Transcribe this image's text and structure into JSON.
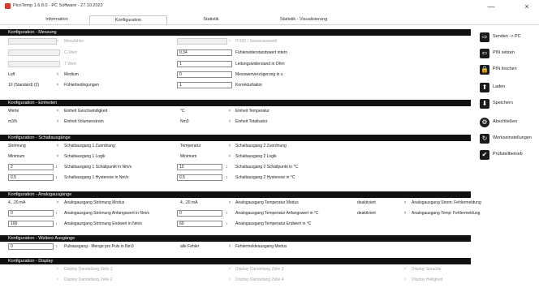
{
  "window": {
    "title": "PicoTemp 1.6.8.0 - PC Software - 27.10.2022",
    "minimize_icon": "minimize-icon",
    "close_icon": "close-icon",
    "close_glyph": "×",
    "minimize_glyph": "—"
  },
  "tabs": [
    {
      "label": "Information"
    },
    {
      "label": "Konfiguration"
    },
    {
      "label": "Statistik"
    },
    {
      "label": "Statistik - Visualisierung"
    }
  ],
  "sections": {
    "messung": "Konfiguration - Messung",
    "fuehrleistungen": "Konfiguration - Einheiten",
    "schaltausgaenge": "Konfiguration - Schaltausgänge",
    "analogausgaenge": "Konfiguration - Analogausgänge",
    "weitere": "Konfiguration - Weitere Ausgänge",
    "display": "Konfiguration - Display"
  },
  "messung": {
    "r1_left_label": "Messfühler",
    "r1_right_label": "Pt100 / Sensorauswahl",
    "r2_left_label": "C-Wert",
    "r2_right_value": "0.34",
    "r2_right_label": "Fühlerwiderstandswert intern",
    "r3_left_label": "T-Wert",
    "r3_right_value": "1",
    "r3_right_label": "Leitungswiderstand in Ohm",
    "r4_left_value": "Luft",
    "r4_left_label": "Medium",
    "r4_right_value": "0",
    "r4_right_label": "Messwertverzögerung in s",
    "r5_left_value": "10 (Standard) (2)",
    "r5_left_label": "Fühlerbedingungen",
    "r5_right_value": "1",
    "r5_right_label": "Korrekturfaktor"
  },
  "einheiten": {
    "r1_left_value": "Werte",
    "r1_left_label": "Einheit Geschwindigkeit",
    "r1_right_value": "°C",
    "r1_right_label": "Einheit Temperatur",
    "r2_left_value": "m3/h",
    "r2_left_label": "Einheit Volumenstrom",
    "r2_right_value": "Nm3",
    "r2_right_label": "Einheit Totalisator"
  },
  "schalt": {
    "r1_left_value": "Strömung",
    "r1_left_label": "Schaltausgang 1 Zuordnung",
    "r1_right_value": "Temperatur",
    "r1_right_label": "Schaltausgang 2 Zuordnung",
    "r2_left_value": "Minimum",
    "r2_left_label": "Schaltausgang 1 Logik",
    "r2_right_value": "Minimum",
    "r2_right_label": "Schaltausgang 2 Logik",
    "r3_left_value": "2",
    "r3_left_label": "Schaltausgang 1 Schaltpunkt in Nm/s",
    "r3_right_value": "10",
    "r3_right_label": "Schaltausgang 2 Schaltpunkt in °C",
    "r4_left_value": "0.5",
    "r4_left_label": "Schaltausgang 1 Hysterese in Nm/s",
    "r4_right_value": "0.5",
    "r4_right_label": "Schaltausgang 2 Hysterese in °C"
  },
  "analog": {
    "r1_left_value": "4...20 mA",
    "r1_left_label": "Analogausgang Strömung Modus",
    "r1_mid_value": "4...20 mA",
    "r1_mid_label": "Analogausgang Temperatur Modus",
    "r1_right_value": "deaktiviert",
    "r1_right_label": "Analogausgang Strom: Fehlermeldung",
    "r2_left_value": "0",
    "r2_left_label": "Analogausgang Strömung Anfangswert in Nm/s",
    "r2_mid_value": "0",
    "r2_mid_label": "Analogausgang Temperatur Anfangswert in °C",
    "r2_right_value": "deaktiviert",
    "r2_right_label": "Analogausgang Temp: Fehlermeldung",
    "r3_left_value": "100",
    "r3_left_label": "Analogausgang Strömung Endwert in Nm/s",
    "r3_mid_value": "60",
    "r3_mid_label": "Analogausgang Temperatur Endwert in °C"
  },
  "weitere": {
    "r1_left_value": "0",
    "r1_left_label": "Pulsausgang - Menge pro Puls in Nm3",
    "r1_right_value": "alle Fehler",
    "r1_right_label": "Fehlermeldeausgang Modus"
  },
  "display": {
    "r1_left_label": "Display Darstellung Zeile 1",
    "r1_mid_label": "Display Darstellung Zeile 3",
    "r1_right_label": "Display Sprache",
    "r2_left_label": "Display Darstellung Zeile 2",
    "r2_mid_label": "Display Darstellung Zeile 4",
    "r2_right_label": "Display Helligkeit"
  },
  "sidebar": {
    "send_label": "Senden -> PC",
    "pin_set_label": "PIN setzen",
    "pin_reset_label": "PIN löschen",
    "load_label": "Laden",
    "save_label": "Speichern",
    "clear_label": "Abschließen",
    "factory_label": "Werkseinstellungen",
    "test_label": "Prüfstellbetrieb"
  },
  "glyphs": {
    "dropdown": "˅",
    "spin": "↕",
    "arrow_right": "⇨",
    "arrow_left": "⇦",
    "lock": "🔒",
    "upload": "⬆",
    "download": "⬇",
    "gear": "⚙",
    "refresh": "↻",
    "check": "✔"
  },
  "colors": {
    "section_header_bg": "#111111",
    "app_icon": "#d13b2e"
  }
}
